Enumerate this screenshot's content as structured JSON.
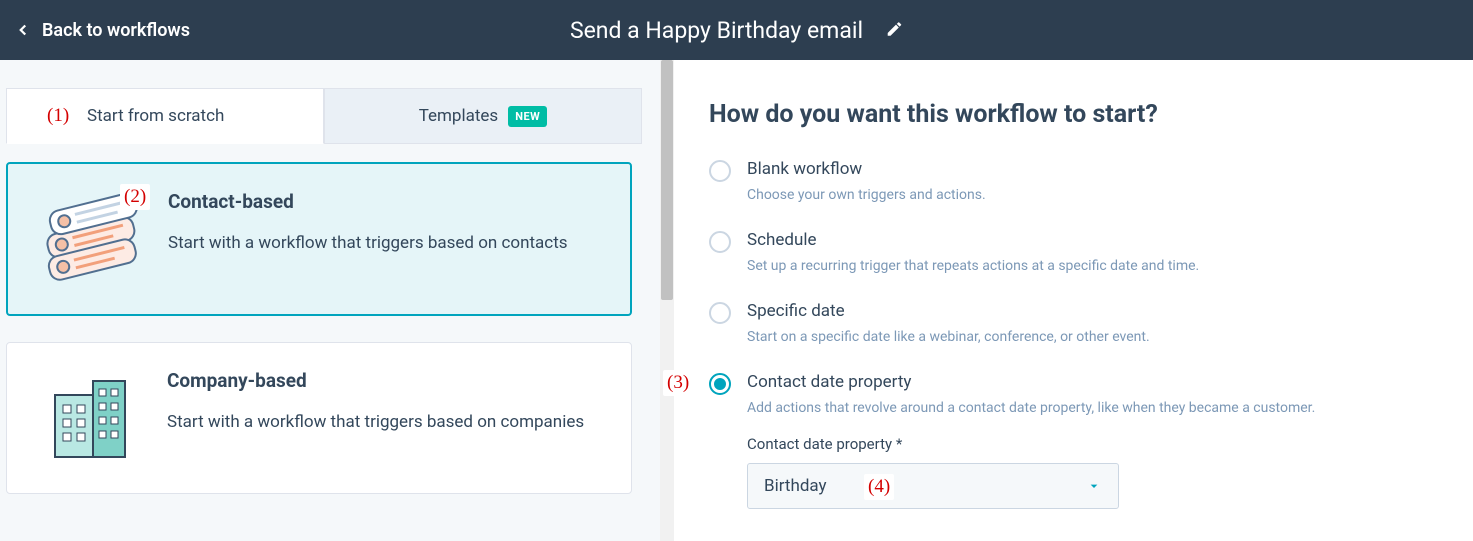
{
  "header": {
    "back_label": "Back to workflows",
    "title": "Send a Happy Birthday email"
  },
  "tabs": {
    "scratch": "Start from scratch",
    "templates": "Templates",
    "templates_badge": "NEW"
  },
  "cards": {
    "contact": {
      "title": "Contact-based",
      "desc": "Start with a workflow that triggers based on contacts"
    },
    "company": {
      "title": "Company-based",
      "desc": "Start with a workflow that triggers based on companies"
    }
  },
  "right": {
    "heading": "How do you want this workflow to start?",
    "options": {
      "blank": {
        "title": "Blank workflow",
        "desc": "Choose your own triggers and actions."
      },
      "schedule": {
        "title": "Schedule",
        "desc": "Set up a recurring trigger that repeats actions at a specific date and time."
      },
      "specific": {
        "title": "Specific date",
        "desc": "Start on a specific date like a webinar, conference, or other event."
      },
      "contact_date": {
        "title": "Contact date property",
        "desc": "Add actions that revolve around a contact date property, like when they became a customer."
      }
    },
    "field": {
      "label": "Contact date property *",
      "value": "Birthday"
    }
  },
  "annotations": {
    "a1": "(1)",
    "a2": "(2)",
    "a3": "(3)",
    "a4": "(4)"
  }
}
